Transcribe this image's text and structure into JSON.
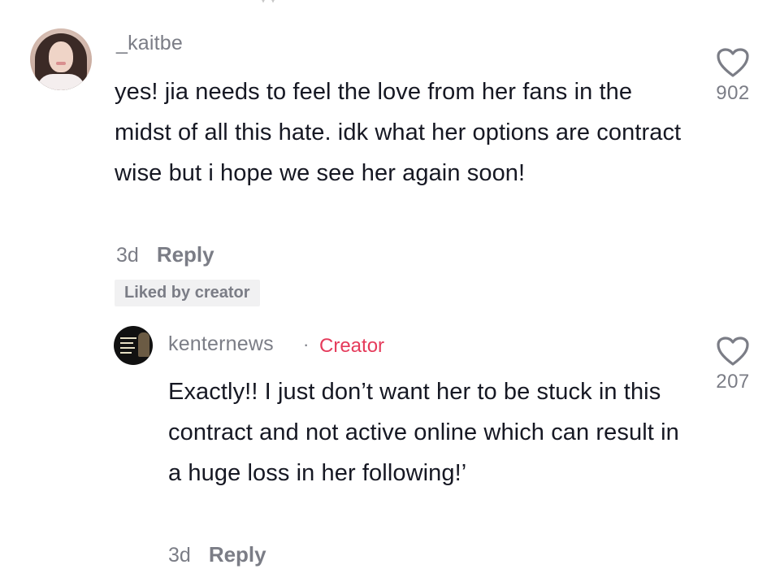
{
  "main_comment": {
    "username": "_kaitbe",
    "text": "yes! jia needs to feel the love from her fans in the midst of all this hate. idk what her options are contract wise but i hope we see her again soon!",
    "timestamp": "3d",
    "reply_label": "Reply",
    "like_count": "902",
    "liked_badge": "Liked by creator",
    "avatar_icon": "user-avatar-icon"
  },
  "reply_comment": {
    "username": "kenternews",
    "separator": "·",
    "badge": "Creator",
    "text": "Exactly!! I just don’t want her to be stuck in this contract and not active online which can result in a huge loss in her following!’",
    "timestamp": "3d",
    "reply_label": "Reply",
    "like_count": "207",
    "avatar_icon": "creator-avatar-icon"
  },
  "colors": {
    "text_primary": "#161823",
    "text_secondary": "#7b7d86",
    "creator_accent": "#e53b5b",
    "badge_bg": "#f1f1f2"
  }
}
